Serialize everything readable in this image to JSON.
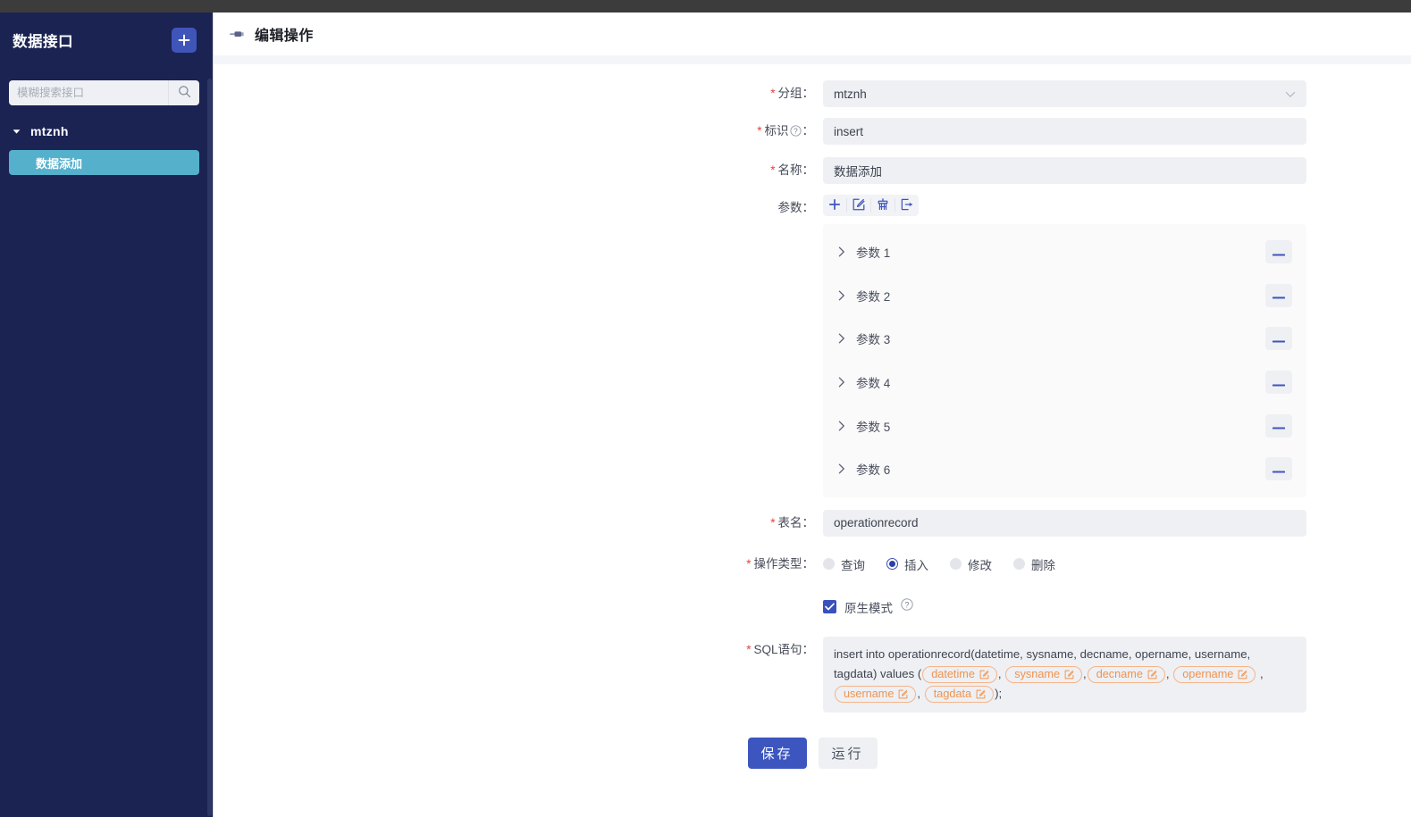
{
  "sidebar": {
    "title": "数据接口",
    "add_button_label": "+",
    "add_button_icon": "plus-icon",
    "search": {
      "placeholder": "模糊搜索接口",
      "value": "",
      "icon": "search-icon"
    },
    "tree": [
      {
        "label": "mtznh",
        "expanded": true,
        "caret_icon": "caret-down-icon",
        "children": [
          {
            "label": "数据添加",
            "selected": true
          }
        ]
      }
    ]
  },
  "header": {
    "icon": "pencil-icon",
    "title": "编辑操作"
  },
  "form": {
    "group": {
      "label": "分组",
      "required": true,
      "value": "mtznh",
      "chevron_icon": "chevron-down-icon"
    },
    "identifier": {
      "label": "标识",
      "required": true,
      "help_icon": "question-circle-icon",
      "value": "insert"
    },
    "name": {
      "label": "名称",
      "required": true,
      "value": "数据添加"
    },
    "params": {
      "label": "参数",
      "toolbar": [
        {
          "name": "add-param-button",
          "icon": "plus-icon"
        },
        {
          "name": "edit-param-button",
          "icon": "edit-square-icon"
        },
        {
          "name": "clear-param-button",
          "icon": "broom-icon"
        },
        {
          "name": "export-param-button",
          "icon": "export-icon"
        }
      ],
      "items": [
        {
          "label": "参数 1",
          "expanded": false,
          "remove_label": "−"
        },
        {
          "label": "参数 2",
          "expanded": false,
          "remove_label": "−"
        },
        {
          "label": "参数 3",
          "expanded": false,
          "remove_label": "−"
        },
        {
          "label": "参数 4",
          "expanded": false,
          "remove_label": "−"
        },
        {
          "label": "参数 5",
          "expanded": false,
          "remove_label": "−"
        },
        {
          "label": "参数 6",
          "expanded": false,
          "remove_label": "−"
        }
      ]
    },
    "table_name": {
      "label": "表名",
      "required": true,
      "value": "operationrecord"
    },
    "operation_type": {
      "label": "操作类型",
      "required": true,
      "options": [
        {
          "label": "查询",
          "selected": false
        },
        {
          "label": "插入",
          "selected": true
        },
        {
          "label": "修改",
          "selected": false
        },
        {
          "label": "删除",
          "selected": false
        }
      ]
    },
    "native_mode": {
      "label": "原生模式",
      "checked": true,
      "help_icon": "question-circle-icon"
    },
    "sql": {
      "label": "SQL语句",
      "required": true,
      "prefix": "insert into operationrecord(datetime, sysname, decname, opername, username, tagdata) values (",
      "tags": [
        "datetime",
        "sysname",
        "decname",
        "opername",
        "username",
        "tagdata"
      ],
      "separator": ",",
      "suffix": ");",
      "tag_icon": "edit-square-icon"
    }
  },
  "actions": {
    "save_label": "保存",
    "run_label": "运行"
  },
  "colors": {
    "sidebar_bg": "#1b2353",
    "accent_blue": "#3d56bf",
    "selected_leaf": "#55b0cc",
    "required_red": "#e8413c",
    "tag_orange": "#f0934f",
    "topbar_dark": "#3c3c3c"
  }
}
